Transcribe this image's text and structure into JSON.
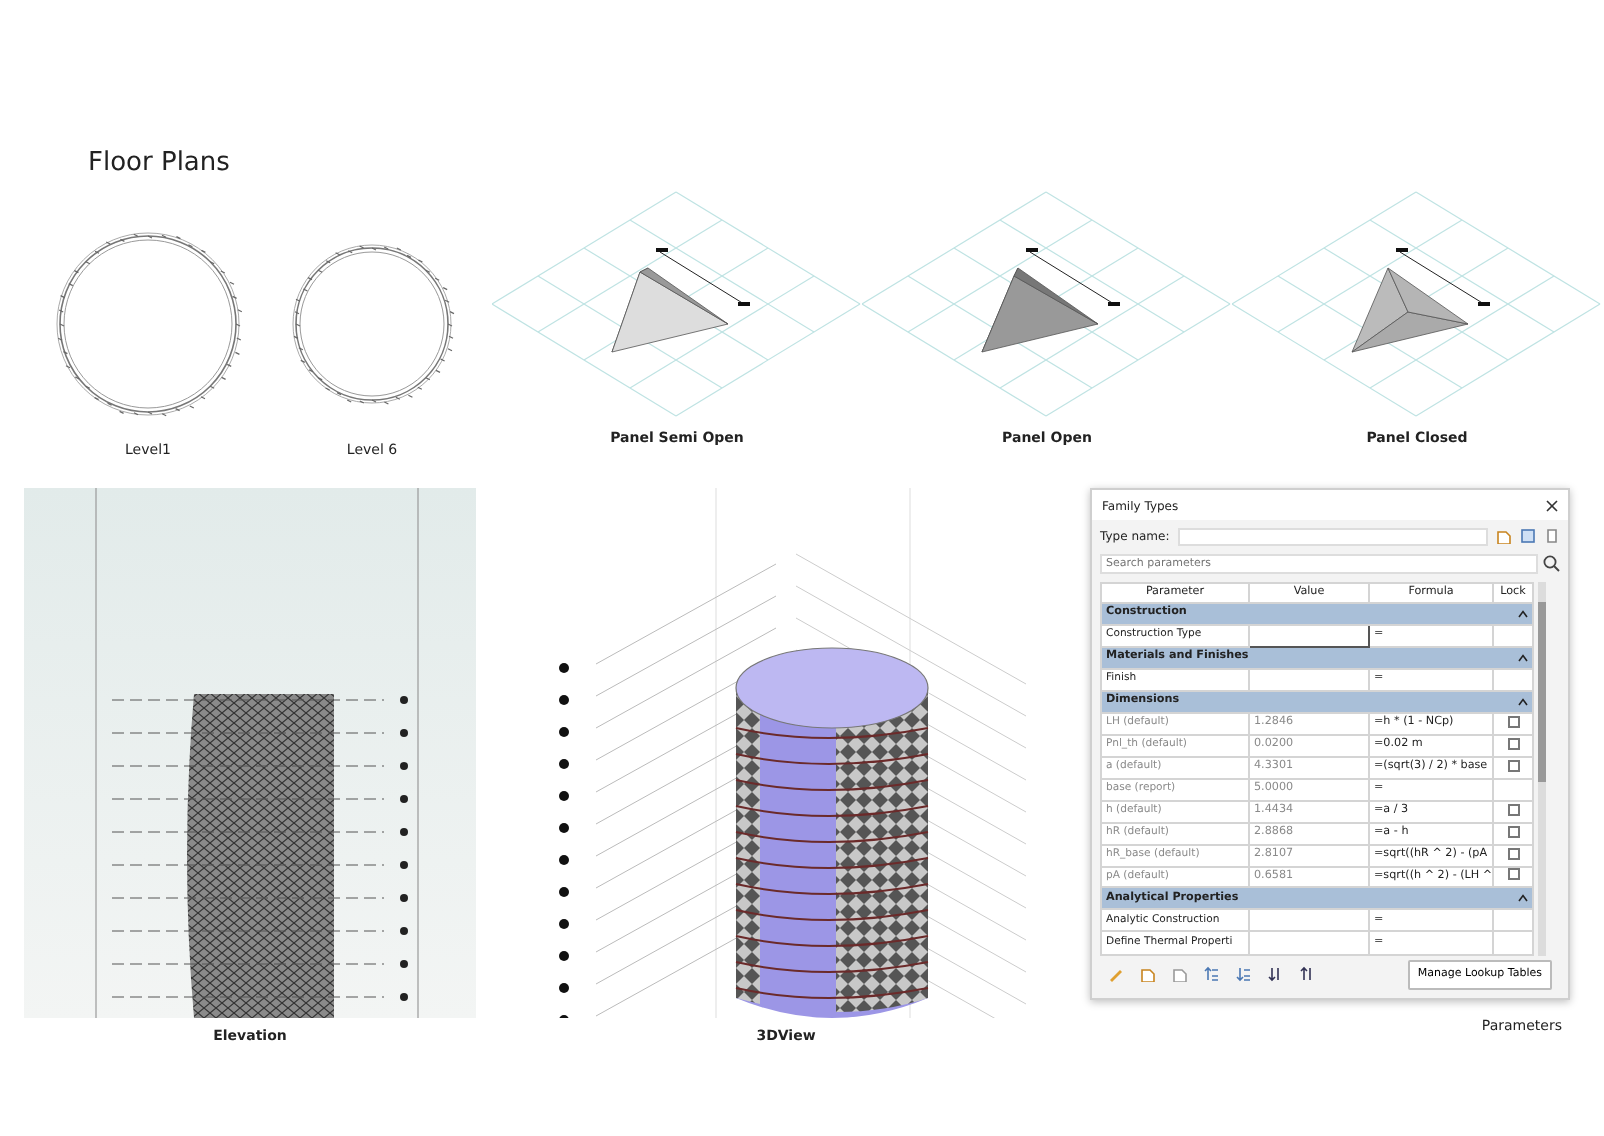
{
  "floor_plans": {
    "title": "Floor Plans",
    "plans": [
      {
        "caption": "Level1"
      },
      {
        "caption": "Level 6"
      }
    ]
  },
  "panels": [
    {
      "caption": "Panel Semi Open",
      "kind": "semi_open"
    },
    {
      "caption": "Panel Open",
      "kind": "open"
    },
    {
      "caption": "Panel Closed",
      "kind": "closed"
    }
  ],
  "elevation": {
    "caption": "Elevation"
  },
  "view_3d": {
    "caption": "3DView"
  },
  "family_types": {
    "title": "Family Types",
    "type_name_label": "Type name:",
    "search_placeholder": "Search parameters",
    "columns": [
      "Parameter",
      "Value",
      "Formula",
      "Lock"
    ],
    "rows": [
      {
        "kind": "group",
        "label": "Construction"
      },
      {
        "kind": "param",
        "name": "Construction Type",
        "editable": true,
        "formula": "=",
        "greyed": false
      },
      {
        "kind": "group",
        "label": "Materials and Finishes"
      },
      {
        "kind": "param",
        "name": "Finish",
        "formula": "=",
        "greyed": false
      },
      {
        "kind": "group",
        "label": "Dimensions"
      },
      {
        "kind": "param",
        "name": "LH (default)",
        "value": "1.2846",
        "formula": "=h * (1 - NCp)",
        "lock": false,
        "greyed": true
      },
      {
        "kind": "param",
        "name": "Pnl_th (default)",
        "value": "0.0200",
        "formula": "=0.02 m",
        "lock": false,
        "greyed": true
      },
      {
        "kind": "param",
        "name": "a (default)",
        "value": "4.3301",
        "formula": "=(sqrt(3) / 2) * base",
        "lock": false,
        "greyed": true
      },
      {
        "kind": "param",
        "name": "base (report)",
        "value": "5.0000",
        "formula": "=",
        "greyed": true
      },
      {
        "kind": "param",
        "name": "h (default)",
        "value": "1.4434",
        "formula": "=a / 3",
        "lock": false,
        "greyed": true
      },
      {
        "kind": "param",
        "name": "hR (default)",
        "value": "2.8868",
        "formula": "=a - h",
        "lock": false,
        "greyed": true
      },
      {
        "kind": "param",
        "name": "hR_base (default)",
        "value": "2.8107",
        "formula": "=sqrt((hR ^ 2) - (pA",
        "lock": false,
        "greyed": true
      },
      {
        "kind": "param",
        "name": "pA (default)",
        "value": "0.6581",
        "formula": "=sqrt((h ^ 2) - (LH ^",
        "lock": false,
        "greyed": true
      },
      {
        "kind": "group",
        "label": "Analytical Properties"
      },
      {
        "kind": "param",
        "name": "Analytic Construction",
        "formula": "=",
        "greyed": false
      },
      {
        "kind": "param",
        "name": "Define Thermal Properti",
        "formula": "=",
        "greyed": false
      }
    ],
    "manage_button": "Manage Lookup Tables",
    "caption": "Parameters"
  }
}
